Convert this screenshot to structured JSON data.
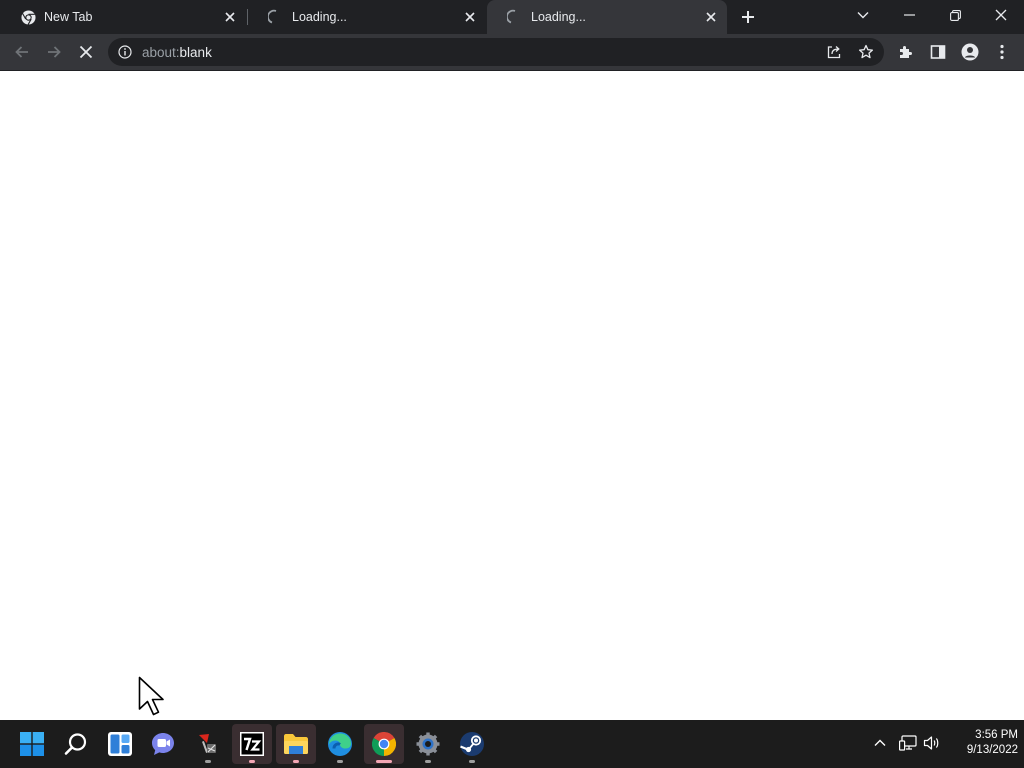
{
  "browser": {
    "tabs": [
      {
        "title": "New Tab",
        "favicon": "chrome-icon",
        "active": false
      },
      {
        "title": "Loading...",
        "favicon": "spinner-icon",
        "active": false
      },
      {
        "title": "Loading...",
        "favicon": "spinner-icon",
        "active": true
      }
    ],
    "address": {
      "scheme": "about:",
      "host": "blank"
    },
    "colors": {
      "frame": "#202124",
      "toolbar": "#35363a",
      "text": "#e8eaed"
    }
  },
  "taskbar": {
    "apps": [
      {
        "name": "start-icon"
      },
      {
        "name": "search-icon"
      },
      {
        "name": "widgets-icon"
      },
      {
        "name": "teams-chat-icon"
      },
      {
        "name": "snipping-tool-icon"
      },
      {
        "name": "7zip-icon"
      },
      {
        "name": "file-explorer-icon"
      },
      {
        "name": "edge-icon"
      },
      {
        "name": "chrome-icon"
      },
      {
        "name": "settings-icon"
      },
      {
        "name": "steam-icon"
      }
    ],
    "clock": {
      "time": "3:56 PM",
      "date": "9/13/2022"
    }
  }
}
